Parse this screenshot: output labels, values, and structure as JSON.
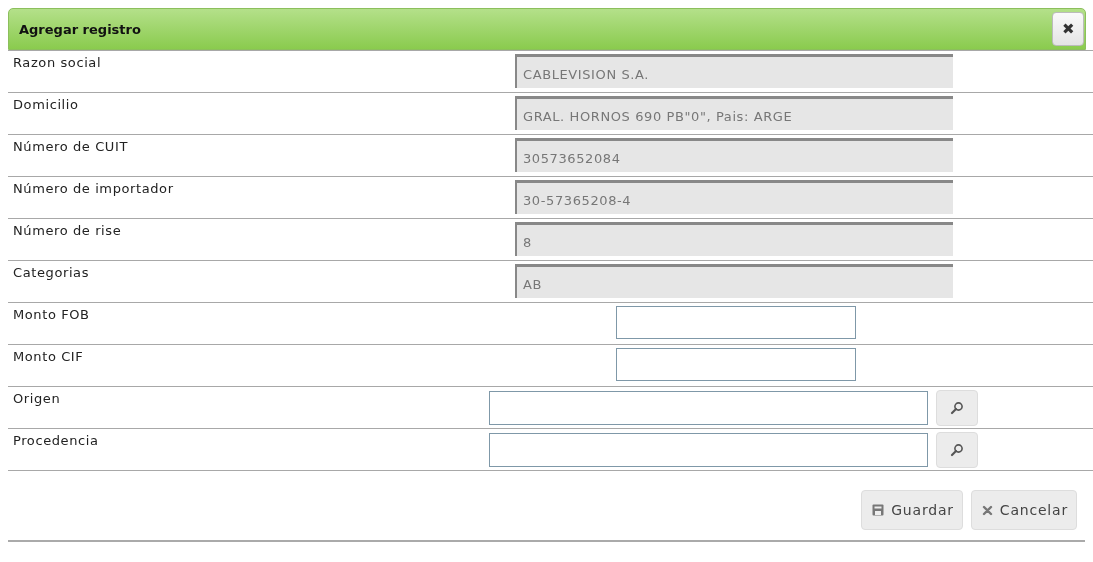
{
  "dialog": {
    "title": "Agregar registro",
    "close_label": "✖"
  },
  "fields": [
    {
      "label": "Razon social",
      "kind": "readonly",
      "value": "CABLEVISION S.A."
    },
    {
      "label": "Domicilio",
      "kind": "readonly",
      "value": "GRAL. HORNOS 690 PB\"0\", Pais: ARGE"
    },
    {
      "label": "Número de CUIT",
      "kind": "readonly",
      "value": "30573652084"
    },
    {
      "label": "Número de importador",
      "kind": "readonly",
      "value": "30-57365208-4"
    },
    {
      "label": "Número de rise",
      "kind": "readonly",
      "value": "8"
    },
    {
      "label": "Categorias",
      "kind": "readonly",
      "value": "AB"
    },
    {
      "label": "Monto FOB",
      "kind": "text"
    },
    {
      "label": "Monto CIF",
      "kind": "text"
    },
    {
      "label": "Origen",
      "kind": "lookup"
    },
    {
      "label": "Procedencia",
      "kind": "lookup"
    }
  ],
  "buttons": [
    {
      "label": "Guardar",
      "kind": "save"
    },
    {
      "label": "Cancelar",
      "kind": "cancel"
    }
  ]
}
